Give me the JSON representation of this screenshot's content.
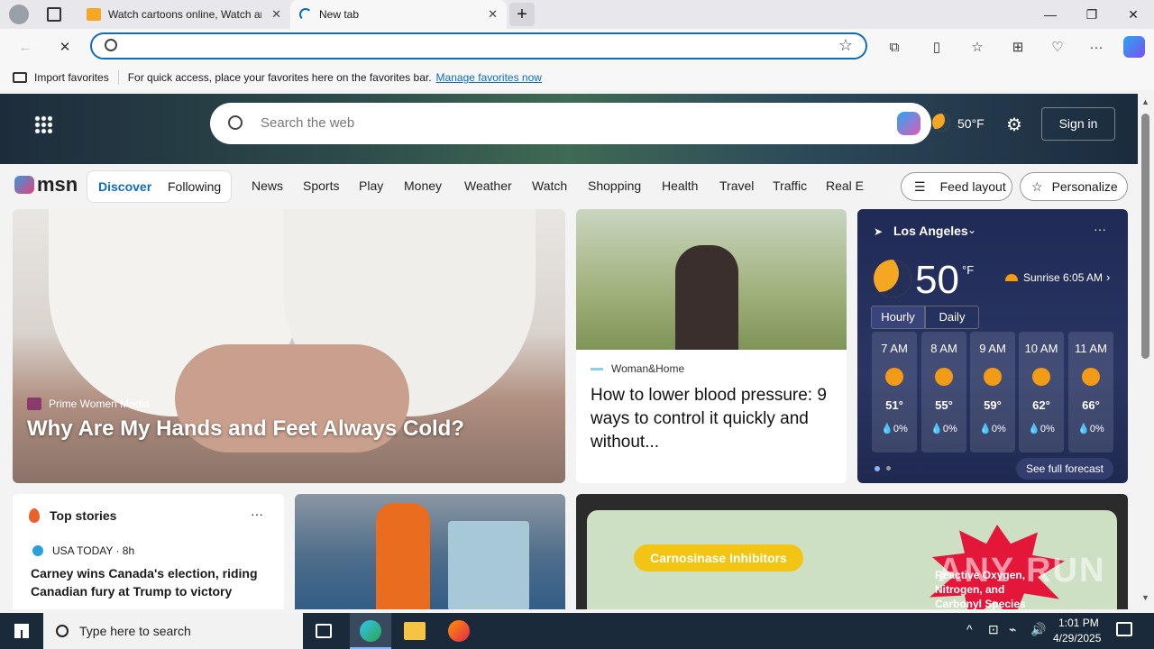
{
  "browser": {
    "tabs": [
      {
        "title": "Watch cartoons online, Watch ani",
        "active": false
      },
      {
        "title": "New tab",
        "active": true
      }
    ],
    "address_value": "",
    "favorites_bar": {
      "import_label": "Import favorites",
      "message": "For quick access, place your favorites here on the favorites bar.",
      "manage_link": "Manage favorites now"
    }
  },
  "msn": {
    "search_placeholder": "Search the web",
    "header_temp": "50°F",
    "signin_label": "Sign in",
    "logo": "msn",
    "toggle": [
      "Discover",
      "Following"
    ],
    "nav_links": [
      "News",
      "Sports",
      "Play",
      "Money",
      "Weather",
      "Watch",
      "Shopping",
      "Health",
      "Travel",
      "Traffic",
      "Real E"
    ],
    "feed_layout_label": "Feed layout",
    "personalize_label": "Personalize"
  },
  "hero_story": {
    "source": "Prime Women Media",
    "title": "Why Are My Hands and Feet Always Cold?"
  },
  "story2": {
    "source": "Woman&Home",
    "title": "How to lower blood pressure: 9 ways to control it quickly and without..."
  },
  "weather": {
    "location": "Los Angeles",
    "temp": "50",
    "unit": "°F",
    "sunrise": "Sunrise  6:05 AM",
    "tabs": [
      "Hourly",
      "Daily"
    ],
    "hours": [
      {
        "time": "7 AM",
        "temp": "51°",
        "precip": "0%"
      },
      {
        "time": "8 AM",
        "temp": "55°",
        "precip": "0%"
      },
      {
        "time": "9 AM",
        "temp": "59°",
        "precip": "0%"
      },
      {
        "time": "10 AM",
        "temp": "62°",
        "precip": "0%"
      },
      {
        "time": "11 AM",
        "temp": "66°",
        "precip": "0%"
      }
    ],
    "see_full_forecast": "See full forecast"
  },
  "top_stories": {
    "header": "Top stories",
    "source": "USA TODAY · 8h",
    "headline": "Carney wins Canada's election, riding Canadian fury at Trump to victory"
  },
  "ad_card": {
    "label1": "Carnosinase Inhibitors",
    "label2": "Reactive Oxygen, Nitrogen, and Carbonyl Species"
  },
  "watermark": "ANY RUN",
  "taskbar": {
    "search_placeholder": "Type here to search",
    "time": "1:01 PM",
    "date": "4/29/2025"
  }
}
